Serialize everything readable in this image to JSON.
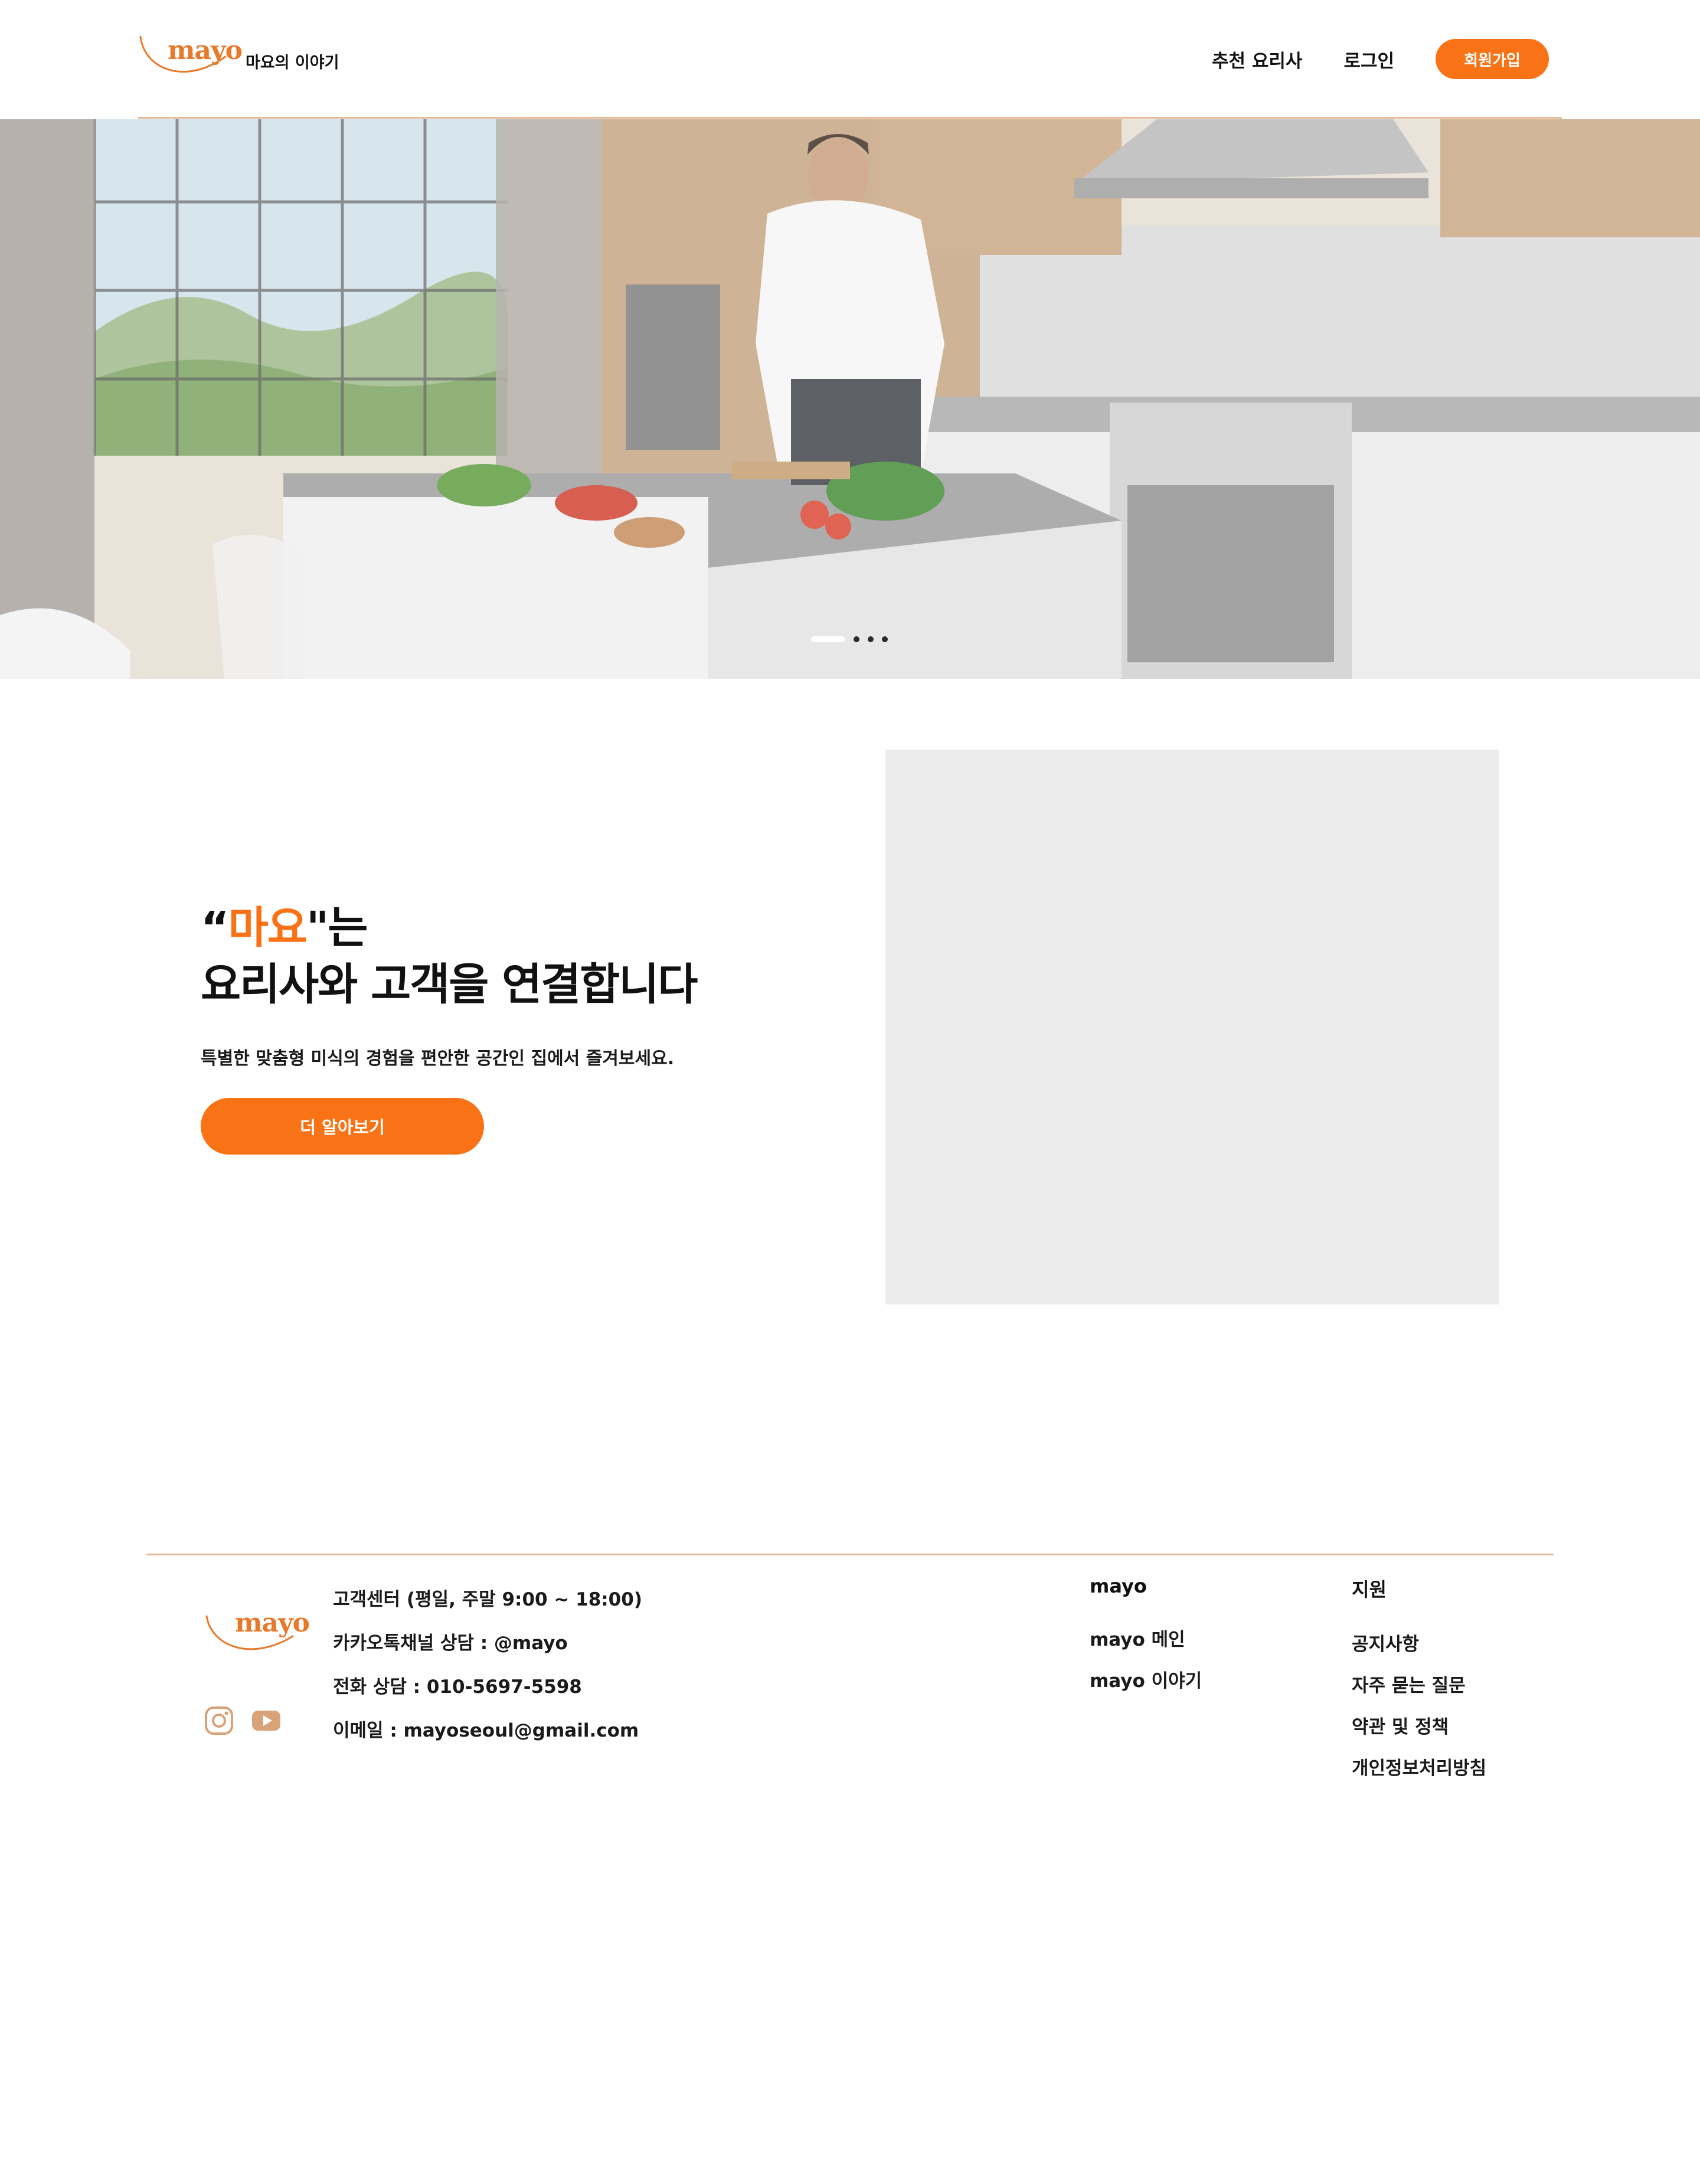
{
  "header": {
    "logo_text": "mayo",
    "logo_subtitle": "마요의 이야기",
    "nav": {
      "recommended_chefs": "추천 요리사",
      "login": "로그인",
      "signup": "회원가입"
    }
  },
  "hero": {
    "slide_count": 4,
    "active_slide": 1
  },
  "intro": {
    "heading_quote_open": "“",
    "heading_brand": "마요",
    "heading_after_brand": "\"는",
    "heading_line2": "요리사와 고객을 연결합니다",
    "description": "특별한 맞춤형 미식의 경험을 편안한 공간인 집에서 즐겨보세요.",
    "cta_label": "더 알아보기"
  },
  "footer": {
    "logo_text": "mayo",
    "social": [
      "instagram-icon",
      "youtube-icon"
    ],
    "contact": {
      "hours": "고객센터 (평일, 주말 9:00 ~ 18:00)",
      "kakao": "카카오톡채널 상담 : @mayo",
      "phone": "전화 상담 : 010-5697-5598",
      "email": "이메일 : mayoseoul@gmail.com"
    },
    "columns": [
      {
        "title": "mayo",
        "links": [
          "mayo 메인",
          "mayo 이야기"
        ]
      },
      {
        "title": "지원",
        "links": [
          "공지사항",
          "자주 묻는 질문",
          "약관 및 정책",
          "개인정보처리방침"
        ]
      }
    ]
  },
  "colors": {
    "accent": "#f97316",
    "logo": "#e8792a",
    "divider": "#e5b896",
    "placeholder": "#ececec"
  }
}
